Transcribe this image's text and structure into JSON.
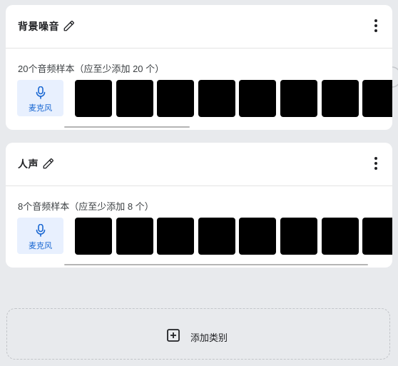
{
  "categories": [
    {
      "title": "背景噪音",
      "sample_label": "20个音频样本（应至少添加 20 个）",
      "mic_label": "麦克风",
      "visible_samples": 8
    },
    {
      "title": "人声",
      "sample_label": "8个音频样本（应至少添加 8 个）",
      "mic_label": "麦克风",
      "visible_samples": 8
    }
  ],
  "add_category": {
    "label": "添加类别"
  },
  "colors": {
    "background": "#e8eaed",
    "card": "#ffffff",
    "mic_button_bg": "#e8f0fe",
    "mic_accent": "#1967d2",
    "sample_tile": "#000000"
  },
  "icons": {
    "edit": "pencil-icon",
    "menu": "more-vert-icon",
    "mic": "microphone-icon",
    "add": "add-box-icon"
  }
}
